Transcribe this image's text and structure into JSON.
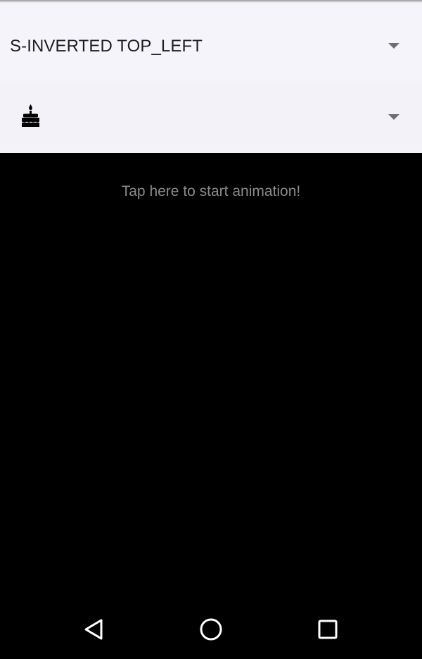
{
  "dropdowns": {
    "style_select": {
      "value": "S-INVERTED TOP_LEFT",
      "caret_icon": "triangle-down-icon"
    },
    "icon_select": {
      "value_icon": "cake-icon",
      "caret_icon": "triangle-down-icon"
    }
  },
  "main": {
    "tap_prompt": "Tap here to start animation!"
  },
  "nav_bar": {
    "back_icon": "back-triangle-icon",
    "home_icon": "home-circle-icon",
    "recent_icon": "recent-square-icon"
  },
  "colors": {
    "panel_background": "#f6f4fb",
    "screen_background": "#000000",
    "prompt_text": "#8a8a8a",
    "dropdown_text": "#1e1e1e"
  }
}
